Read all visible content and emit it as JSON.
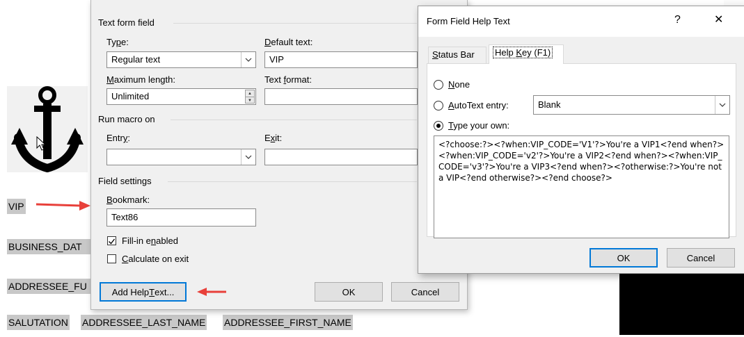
{
  "document": {
    "fields": {
      "vip": "VIP",
      "business_date": "BUSINESS_DAT",
      "addressee_full": "ADDRESSEE_FU",
      "salutation": "SALUTATION",
      "addressee_last_name": "ADDRESSEE_LAST_NAME",
      "addressee_first_name": "ADDRESSEE_FIRST_NAME"
    },
    "anchor_icon": "anchor-icon",
    "arrow_color": "#e8403a",
    "field_shading": "#c8c8c8"
  },
  "form_field_options": {
    "section_text_form_field": "Text form field",
    "type_label": "Type:",
    "type_value": "Regular text",
    "default_text_label": "Default text:",
    "default_text_value": "VIP",
    "max_length_label": "Maximum length:",
    "max_length_value": "Unlimited",
    "text_format_label": "Text format:",
    "text_format_value": "",
    "section_run_macro": "Run macro on",
    "entry_label": "Entry:",
    "entry_value": "",
    "exit_label": "Exit:",
    "exit_value": "",
    "section_field_settings": "Field settings",
    "bookmark_label": "Bookmark:",
    "bookmark_value": "Text86",
    "fill_in_enabled_label": "Fill-in enabled",
    "fill_in_enabled_checked": true,
    "calculate_on_exit_label": "Calculate on exit",
    "calculate_on_exit_checked": false,
    "add_help_text_button": "Add Help Text...",
    "ok_button": "OK",
    "cancel_button": "Cancel"
  },
  "help_text_dialog": {
    "title": "Form Field Help Text",
    "help_glyph": "?",
    "close_glyph": "✕",
    "tabs": [
      {
        "label": "Status Bar",
        "active": false
      },
      {
        "label": "Help Key (F1)",
        "active": true
      }
    ],
    "options": {
      "none_label": "None",
      "autotext_label": "AutoText entry:",
      "autotext_value": "Blank",
      "type_your_own_label": "Type your own:",
      "selected": "type_your_own"
    },
    "help_text": "<?choose:?><?when:VIP_CODE='V1'?>You're a VIP1<?end when?><?when:VIP_CODE='v2'?>You're a VIP2<?end when?><?when:VIP_CODE='v3'?>You're a VIP3<?end when?><?otherwise:?>You're not a VIP<?end otherwise?><?end choose?>",
    "ok_button": "OK",
    "cancel_button": "Cancel",
    "focus_color": "#0078d7"
  }
}
